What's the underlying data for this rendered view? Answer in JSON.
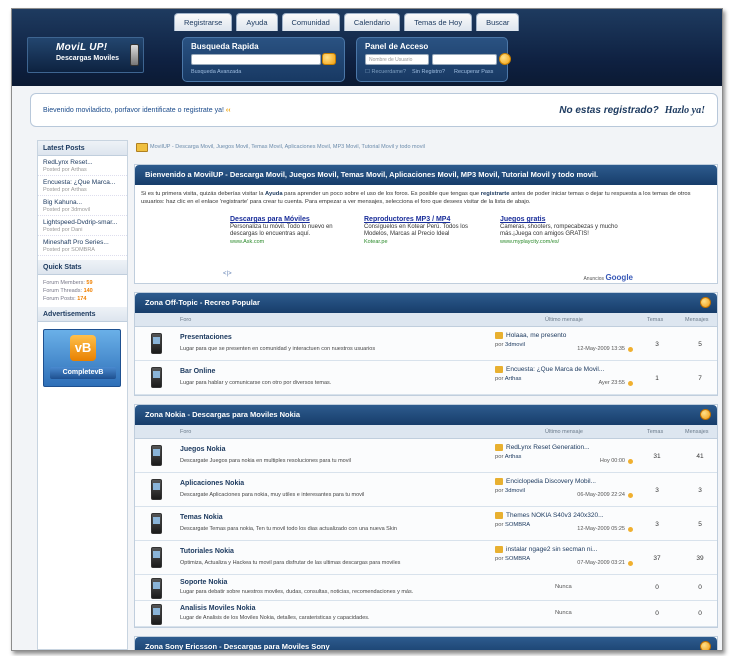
{
  "header": {
    "logo_title": "MoviL UP!",
    "logo_subtitle": "Descargas Moviles",
    "tabs": [
      "Registrarse",
      "Ayuda",
      "Comunidad",
      "Calendario",
      "Temas de Hoy",
      "Buscar"
    ],
    "search": {
      "title": "Busqueda Rapida",
      "advanced": "Busqueda Avanzada"
    },
    "login": {
      "title": "Panel de Acceso",
      "username_placeholder": "Nombre de Usuario",
      "remember": "Recuerdame?",
      "no_account": "Sin Registro?",
      "recover": "Recuperar Pass"
    }
  },
  "welcome": {
    "text": "Bievenido moviladicto, porfavor identificate o registrate ya!",
    "arrows": "‹‹",
    "right": "No estas registrado?",
    "right_bold": "Hazlo ya!"
  },
  "sidebar": {
    "latest_title": "Latest Posts",
    "posts": [
      {
        "title": "RedLynx Reset...",
        "by": "Posted por Arthas"
      },
      {
        "title": "Encuesta: ¿Que Marca...",
        "by": "Posted por Arthas"
      },
      {
        "title": "Big Kahuna...",
        "by": "Posted por 3dmovil"
      },
      {
        "title": "Lightspeed-Dvdrip-smar...",
        "by": "Posted por Dani"
      },
      {
        "title": "Mineshaft Pro Series...",
        "by": "Posted por SOMBRA"
      }
    ],
    "stats_title": "Quick Stats",
    "stats": [
      {
        "label": "Forum Members:",
        "value": "59"
      },
      {
        "label": "Forum Threads:",
        "value": "140"
      },
      {
        "label": "Forum Posts:",
        "value": "174"
      }
    ],
    "ads_title": "Advertisements",
    "vb_logo": "vB",
    "vb_label": "CompletevB"
  },
  "breadcrumb": "MovilUP - Descarga Movil, Juegos Movil, Temas Movil, Aplicaciones Movil, MP3 Movil, Tutorial Movil y todo movil",
  "intro": {
    "title": "Bienvenido a MovilUP - Descarga Movil, Juegos Movil, Temas Movil, Aplicaciones Movil, MP3 Movil, Tutorial Movil y todo movil.",
    "p1": "Si es tu primera visita, quizás deberías visitar la ",
    "help": "Ayuda",
    "p2": " para aprender un poco sobre el uso de los foros. Es posible que tengas que ",
    "reg": "registrarte",
    "p3": " antes de poder iniciar temas o dejar tu respuesta a los temas de otros usuarios: haz clic en el enlace 'registrarte' para crear tu cuenta. Para empezar a ver mensajes, selecciona el foro que desees visitar de la lista de abajo.",
    "ads": [
      {
        "h": "Descargas para Móviles",
        "d": "Personaliza tu móvil. Todo lo nuevo en descargas lo encuentras aquí.",
        "u": "www.Ask.com"
      },
      {
        "h": "Reproductores MP3 / MP4",
        "d": "Consíguelos en Kotear Perú. Todos los Modelos, Marcas al Precio Ideal",
        "u": "Kotear.pe"
      },
      {
        "h": "Juegos gratis",
        "d": "Cameras, shooters, rompecabezas y mucho más.¡Juega con amigos GRATIS!",
        "u": "www.myplaycity.com/es/"
      }
    ],
    "google": "Anuncios",
    "google_b": "Google",
    "nav": "<|>"
  },
  "columns": {
    "forum": "Foro",
    "last": "Último mensaje",
    "threads": "Temas",
    "posts": "Mensajes"
  },
  "sections": [
    {
      "title": "Zona Off-Topic - Recreo Popular",
      "rows": [
        {
          "name": "Presentaciones",
          "desc": "Lugar para que se presenten en comunidad y interactuen con nuestros usuarios",
          "last": "Holaaa, me presento",
          "by": "3dmovil",
          "date": "12-May-2009 13:35",
          "threads": "3",
          "posts": "5"
        },
        {
          "name": "Bar Online",
          "desc": "Lugar para hablar y comunicarse con otro por diversos temas.",
          "last": "Encuesta: ¿Que Marca de Movil...",
          "by": "Arthas",
          "date": "Ayer 23:55",
          "threads": "1",
          "posts": "7"
        }
      ]
    },
    {
      "title": "Zona Nokia - Descargas para Moviles Nokia",
      "rows": [
        {
          "name": "Juegos Nokia",
          "desc": "Descargate Juegos para nokia en multiples resoluciones para tu movil",
          "last": "RedLynx Reset Generation...",
          "by": "Arthas",
          "date": "Hoy 00:00",
          "threads": "31",
          "posts": "41"
        },
        {
          "name": "Aplicaciones Nokia",
          "desc": "Descargate Aplicaciones para nokia, muy utiles e interesantes para tu movil",
          "last": "Enciclopedia Discovery Mobil...",
          "by": "3dmovil",
          "date": "06-May-2009 22:24",
          "threads": "3",
          "posts": "3"
        },
        {
          "name": "Temas Nokia",
          "desc": "Descargate Temas para nokia, Ten tu movil todo los dias actualizado con una nueva Skin",
          "last": "Themes NOKIA S40v3 240x320...",
          "by": "SOMBRA",
          "date": "12-May-2009 05:25",
          "threads": "3",
          "posts": "5"
        },
        {
          "name": "Tutoriales Nokia",
          "desc": "Optimiza, Actualiza y Hackea tu movil para disfrutar de las ultimas descargas para moviles",
          "last": "instalar ngage2 sin secman ni...",
          "by": "SOMBRA",
          "date": "07-May-2009 03:21",
          "threads": "37",
          "posts": "39"
        },
        {
          "name": "Soporte Nokia",
          "desc": "Lugar para debatir sobre nuestros moviles, dudas, consultas, noticias, recomendaciones y más.",
          "none": "Nunca",
          "threads": "0",
          "posts": "0"
        },
        {
          "name": "Analisis Moviles Nokia",
          "desc": "Lugar de Analisis de los Moviles Nokia, detalles, carateristicas y capacidades.",
          "none": "Nunca",
          "threads": "0",
          "posts": "0"
        }
      ]
    },
    {
      "title": "Zona Sony Ericsson - Descargas para Moviles Sony",
      "rows": []
    }
  ],
  "by_prefix": "por"
}
